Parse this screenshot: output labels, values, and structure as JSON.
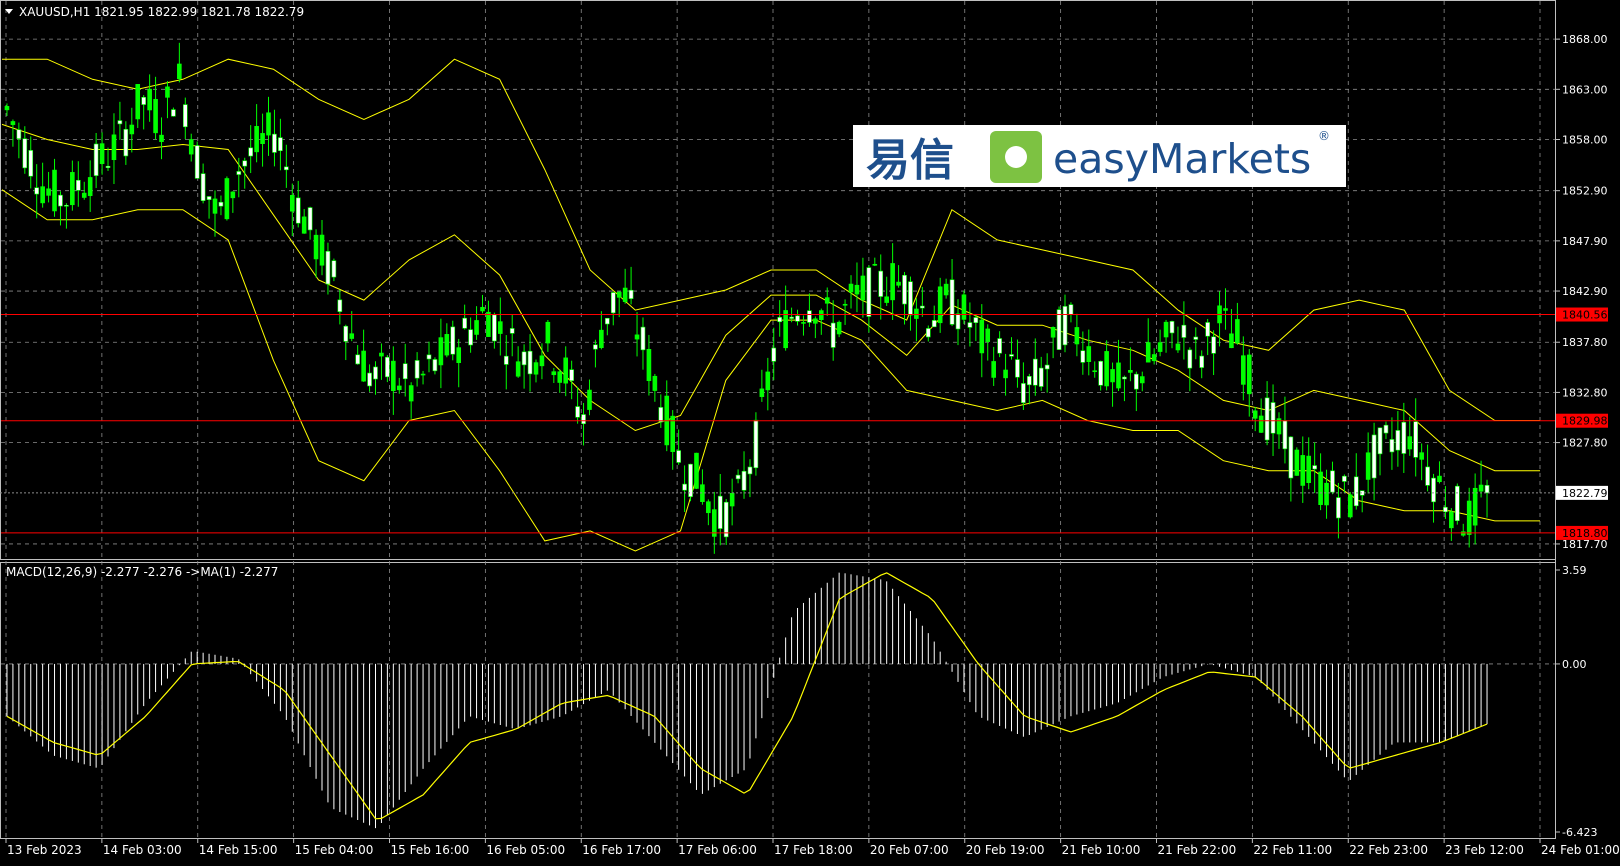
{
  "window": {
    "symbol_header": "XAUUSD,H1  1821.95 1822.99 1821.78 1822.79",
    "macd_header": "MACD(12,26,9) -2.277 -2.276  ->MA(1) -2.277"
  },
  "logo": {
    "chinese": "易信",
    "brand": "easyMarkets",
    "registered": "®"
  },
  "colors": {
    "background": "#000000",
    "grid": "#8c8c8c",
    "bull_candle": "#00ff00",
    "bear_candle": "#ffffff",
    "bollinger": "#ffff00",
    "level_line": "#ff0000",
    "macd_hist": "#ffffff",
    "signal": "#ffff00",
    "logo_blue": "#1e4f8c",
    "logo_green": "#7dc242"
  },
  "price_axis": {
    "ticks": [
      "1868.00",
      "1863.00",
      "1858.00",
      "1852.90",
      "1847.90",
      "1842.90",
      "1837.80",
      "1832.80",
      "1827.80",
      "1817.70"
    ],
    "current_price": "1822.79"
  },
  "levels": [
    {
      "label": "1840.56",
      "value": 1840.56
    },
    {
      "label": "1829.98",
      "value": 1829.98
    },
    {
      "label": "1818.80",
      "value": 1818.8
    }
  ],
  "macd_axis": {
    "ticks": [
      "3.59",
      "0.00",
      "-6.423"
    ]
  },
  "time_axis": {
    "labels": [
      "13 Feb 2023",
      "14 Feb 03:00",
      "14 Feb 15:00",
      "15 Feb 04:00",
      "15 Feb 16:00",
      "16 Feb 05:00",
      "16 Feb 17:00",
      "17 Feb 06:00",
      "17 Feb 18:00",
      "20 Feb 07:00",
      "20 Feb 19:00",
      "21 Feb 10:00",
      "21 Feb 22:00",
      "22 Feb 11:00",
      "22 Feb 23:00",
      "23 Feb 12:00",
      "24 Feb 01:00"
    ]
  },
  "chart_data": {
    "type": "candlestick",
    "symbol": "XAUUSD",
    "timeframe": "H1",
    "last_bar": {
      "open": 1821.95,
      "high": 1822.99,
      "low": 1821.78,
      "close": 1822.79
    },
    "price_range": [
      1816.5,
      1871.5
    ],
    "close_path": [
      1861,
      1857,
      1853,
      1852,
      1854,
      1856,
      1858,
      1862,
      1860,
      1864,
      1855,
      1850,
      1855,
      1857,
      1859,
      1852,
      1848,
      1844,
      1838,
      1834,
      1835,
      1833,
      1835,
      1837,
      1839,
      1841,
      1838,
      1836,
      1838,
      1835,
      1830,
      1840,
      1843,
      1838,
      1832,
      1826,
      1824,
      1820,
      1822,
      1828,
      1838,
      1841,
      1842,
      1839,
      1842,
      1843,
      1844,
      1843,
      1840,
      1842,
      1840,
      1837,
      1836,
      1833,
      1835,
      1840,
      1838,
      1835,
      1833,
      1835,
      1837,
      1839,
      1836,
      1840,
      1838,
      1832,
      1829,
      1826,
      1824,
      1823,
      1822,
      1826,
      1828,
      1829,
      1825,
      1822,
      1820,
      1822.79
    ],
    "bollinger_upper_path": [
      1866,
      1866,
      1864,
      1863,
      1864,
      1866,
      1865,
      1862,
      1860,
      1862,
      1866,
      1864,
      1855,
      1845,
      1841,
      1842,
      1843,
      1845,
      1845,
      1842,
      1840,
      1851,
      1848,
      1847,
      1846,
      1845,
      1841,
      1838,
      1837,
      1841,
      1842,
      1841,
      1833,
      1830,
      1830
    ],
    "bollinger_lower_path": [
      1853,
      1850,
      1850,
      1851,
      1851,
      1848,
      1836,
      1826,
      1824,
      1830,
      1831,
      1825,
      1818,
      1819,
      1817,
      1819,
      1834,
      1840,
      1840,
      1838,
      1833,
      1832,
      1831,
      1832,
      1830,
      1829,
      1829,
      1826,
      1825,
      1825,
      1822,
      1821,
      1821,
      1820,
      1820
    ],
    "macd_range": [
      -6.423,
      3.59
    ],
    "macd_path": [
      -2.0,
      -3.5,
      -4.0,
      -1.5,
      0.5,
      0.2,
      -2.0,
      -5.5,
      -6.3,
      -4.0,
      -2.0,
      -2.5,
      -2.0,
      -1.0,
      -3.0,
      -5.0,
      -4.0,
      2.0,
      3.5,
      3.2,
      1.0,
      -2.0,
      -2.8,
      -2.0,
      -1.5,
      -0.5,
      0,
      -0.5,
      -2.5,
      -4.5,
      -3.0,
      -3.0,
      -2.3
    ],
    "signal_path": [
      -2.0,
      -3.0,
      -3.5,
      -2.0,
      0,
      0.1,
      -1.0,
      -3.5,
      -6.0,
      -5.0,
      -3.0,
      -2.5,
      -1.5,
      -1.2,
      -2.0,
      -4.0,
      -5.0,
      -2.0,
      2.5,
      3.5,
      2.5,
      0,
      -2.0,
      -2.6,
      -2.0,
      -1.0,
      -0.3,
      -0.5,
      -2.0,
      -4.0,
      -3.5,
      -3.0,
      -2.3
    ]
  }
}
